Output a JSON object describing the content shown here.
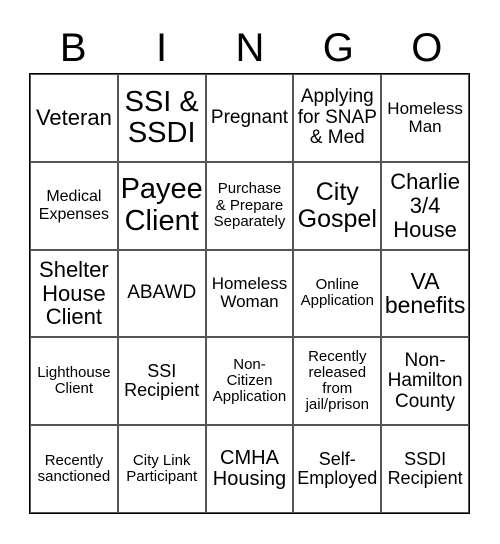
{
  "header": {
    "letters": [
      "B",
      "I",
      "N",
      "G",
      "O"
    ]
  },
  "cells": [
    "Veteran",
    "SSI &\nSSDI",
    "Pregnant",
    "Applying\nfor SNAP\n& Med",
    "Homeless\nMan",
    "Medical\nExpenses",
    "Payee\nClient",
    "Purchase\n& Prepare\nSeparately",
    "City\nGospel",
    "Charlie\n3/4\nHouse",
    "Shelter\nHouse\nClient",
    "ABAWD",
    "Homeless\nWoman",
    "Online\nApplication",
    "VA\nbenefits",
    "Lighthouse\nClient",
    "SSI\nRecipient",
    "Non-\nCitizen\nApplication",
    "Recently\nreleased\nfrom\njail/prison",
    "Non-\nHamilton\nCounty",
    "Recently\nsanctioned",
    "City Link\nParticipant",
    "CMHA\nHousing",
    "Self-\nEmployed",
    "SSDI\nRecipient"
  ]
}
